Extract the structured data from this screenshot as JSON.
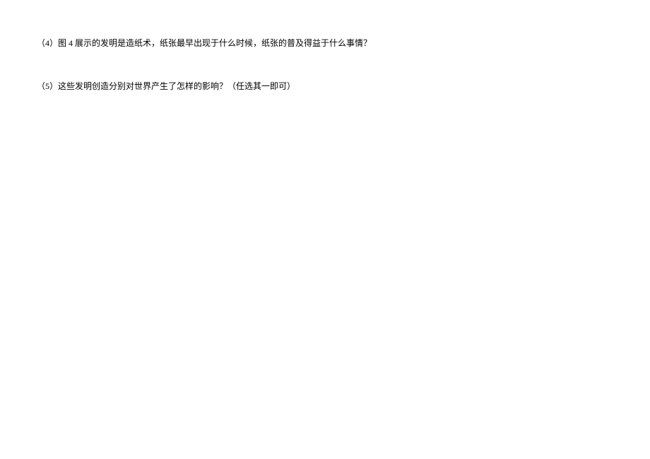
{
  "questions": [
    {
      "text": "（4）图 4 展示的发明是造纸术，纸张最早出现于什么时候，纸张的普及得益于什么事情？"
    },
    {
      "text": "（5）这些发明创造分别对世界产生了怎样的影响？（任选其一即可）"
    }
  ]
}
